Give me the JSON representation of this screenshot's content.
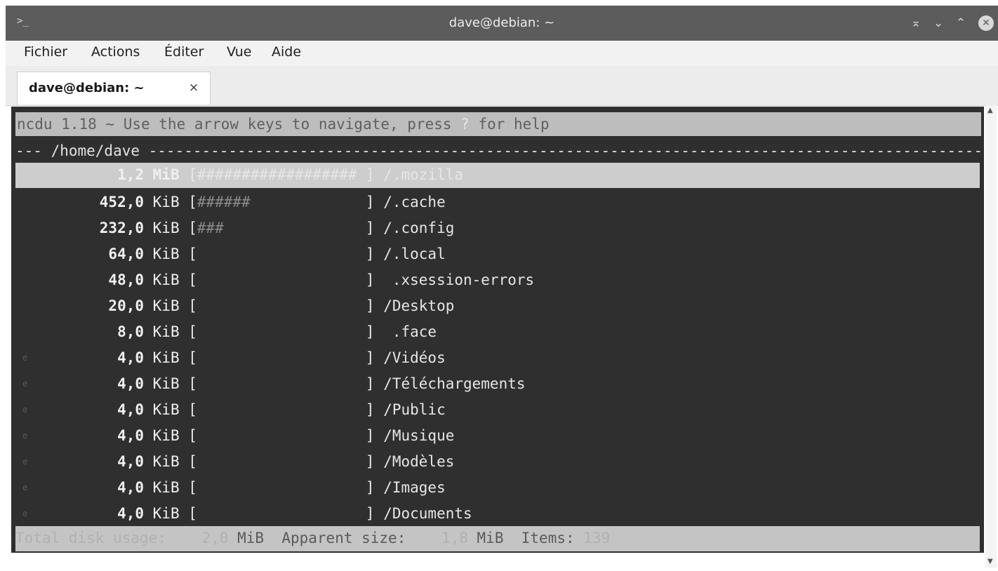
{
  "window": {
    "title": "dave@debian: ~",
    "app_icon": ">_",
    "controls": {
      "keep_above": "⌅",
      "minimize": "⌄",
      "maximize": "⌃",
      "close": "✕"
    }
  },
  "menu": [
    "Fichier",
    "Actions",
    "Éditer",
    "Vue",
    "Aide"
  ],
  "tab": {
    "label": "dave@debian: ~",
    "close": "×"
  },
  "ncdu": {
    "header_prefix": "ncdu 1.18 ~ Use the arrow keys to navigate, press ",
    "header_key": "?",
    "header_suffix": " for help",
    "path_line": "--- /home/dave ---------------------------------------------------------------------------------------------------------",
    "selected": {
      "size": "1,2",
      "unit": "MiB",
      "bar": "##################",
      "name": "/.mozilla"
    },
    "entries": [
      {
        "size": "452,0",
        "unit": "KiB",
        "bar": "######",
        "name": "/.cache",
        "mark": ""
      },
      {
        "size": "232,0",
        "unit": "KiB",
        "bar": "###",
        "name": "/.config",
        "mark": ""
      },
      {
        "size": "64,0",
        "unit": "KiB",
        "bar": "",
        "name": "/.local",
        "mark": ""
      },
      {
        "size": "48,0",
        "unit": "KiB",
        "bar": "",
        "name": " .xsession-errors",
        "mark": ""
      },
      {
        "size": "20,0",
        "unit": "KiB",
        "bar": "",
        "name": "/Desktop",
        "mark": ""
      },
      {
        "size": "8,0",
        "unit": "KiB",
        "bar": "",
        "name": " .face",
        "mark": ""
      },
      {
        "size": "4,0",
        "unit": "KiB",
        "bar": "",
        "name": "/Vidéos",
        "mark": "e"
      },
      {
        "size": "4,0",
        "unit": "KiB",
        "bar": "",
        "name": "/Téléchargements",
        "mark": "e"
      },
      {
        "size": "4,0",
        "unit": "KiB",
        "bar": "",
        "name": "/Public",
        "mark": "e"
      },
      {
        "size": "4,0",
        "unit": "KiB",
        "bar": "",
        "name": "/Musique",
        "mark": "e"
      },
      {
        "size": "4,0",
        "unit": "KiB",
        "bar": "",
        "name": "/Modèles",
        "mark": "e"
      },
      {
        "size": "4,0",
        "unit": "KiB",
        "bar": "",
        "name": "/Images",
        "mark": "e"
      },
      {
        "size": "4,0",
        "unit": "KiB",
        "bar": "",
        "name": "/Documents",
        "mark": "e"
      }
    ],
    "status": {
      "total_label": "Total disk usage:",
      "total_value": "2,0",
      "total_unit": "MiB",
      "apparent_label": "Apparent size:",
      "apparent_value": "1,8",
      "apparent_unit": "MiB",
      "items_label": "Items:",
      "items_value": "139"
    }
  },
  "colors": {
    "titlebar": "#5c5c5c",
    "terminal_bg": "#2f2f2f",
    "header_bg": "#bdbdbd",
    "selected_bg": "#cdcdcd",
    "status_bg": "#c4c4c4"
  }
}
